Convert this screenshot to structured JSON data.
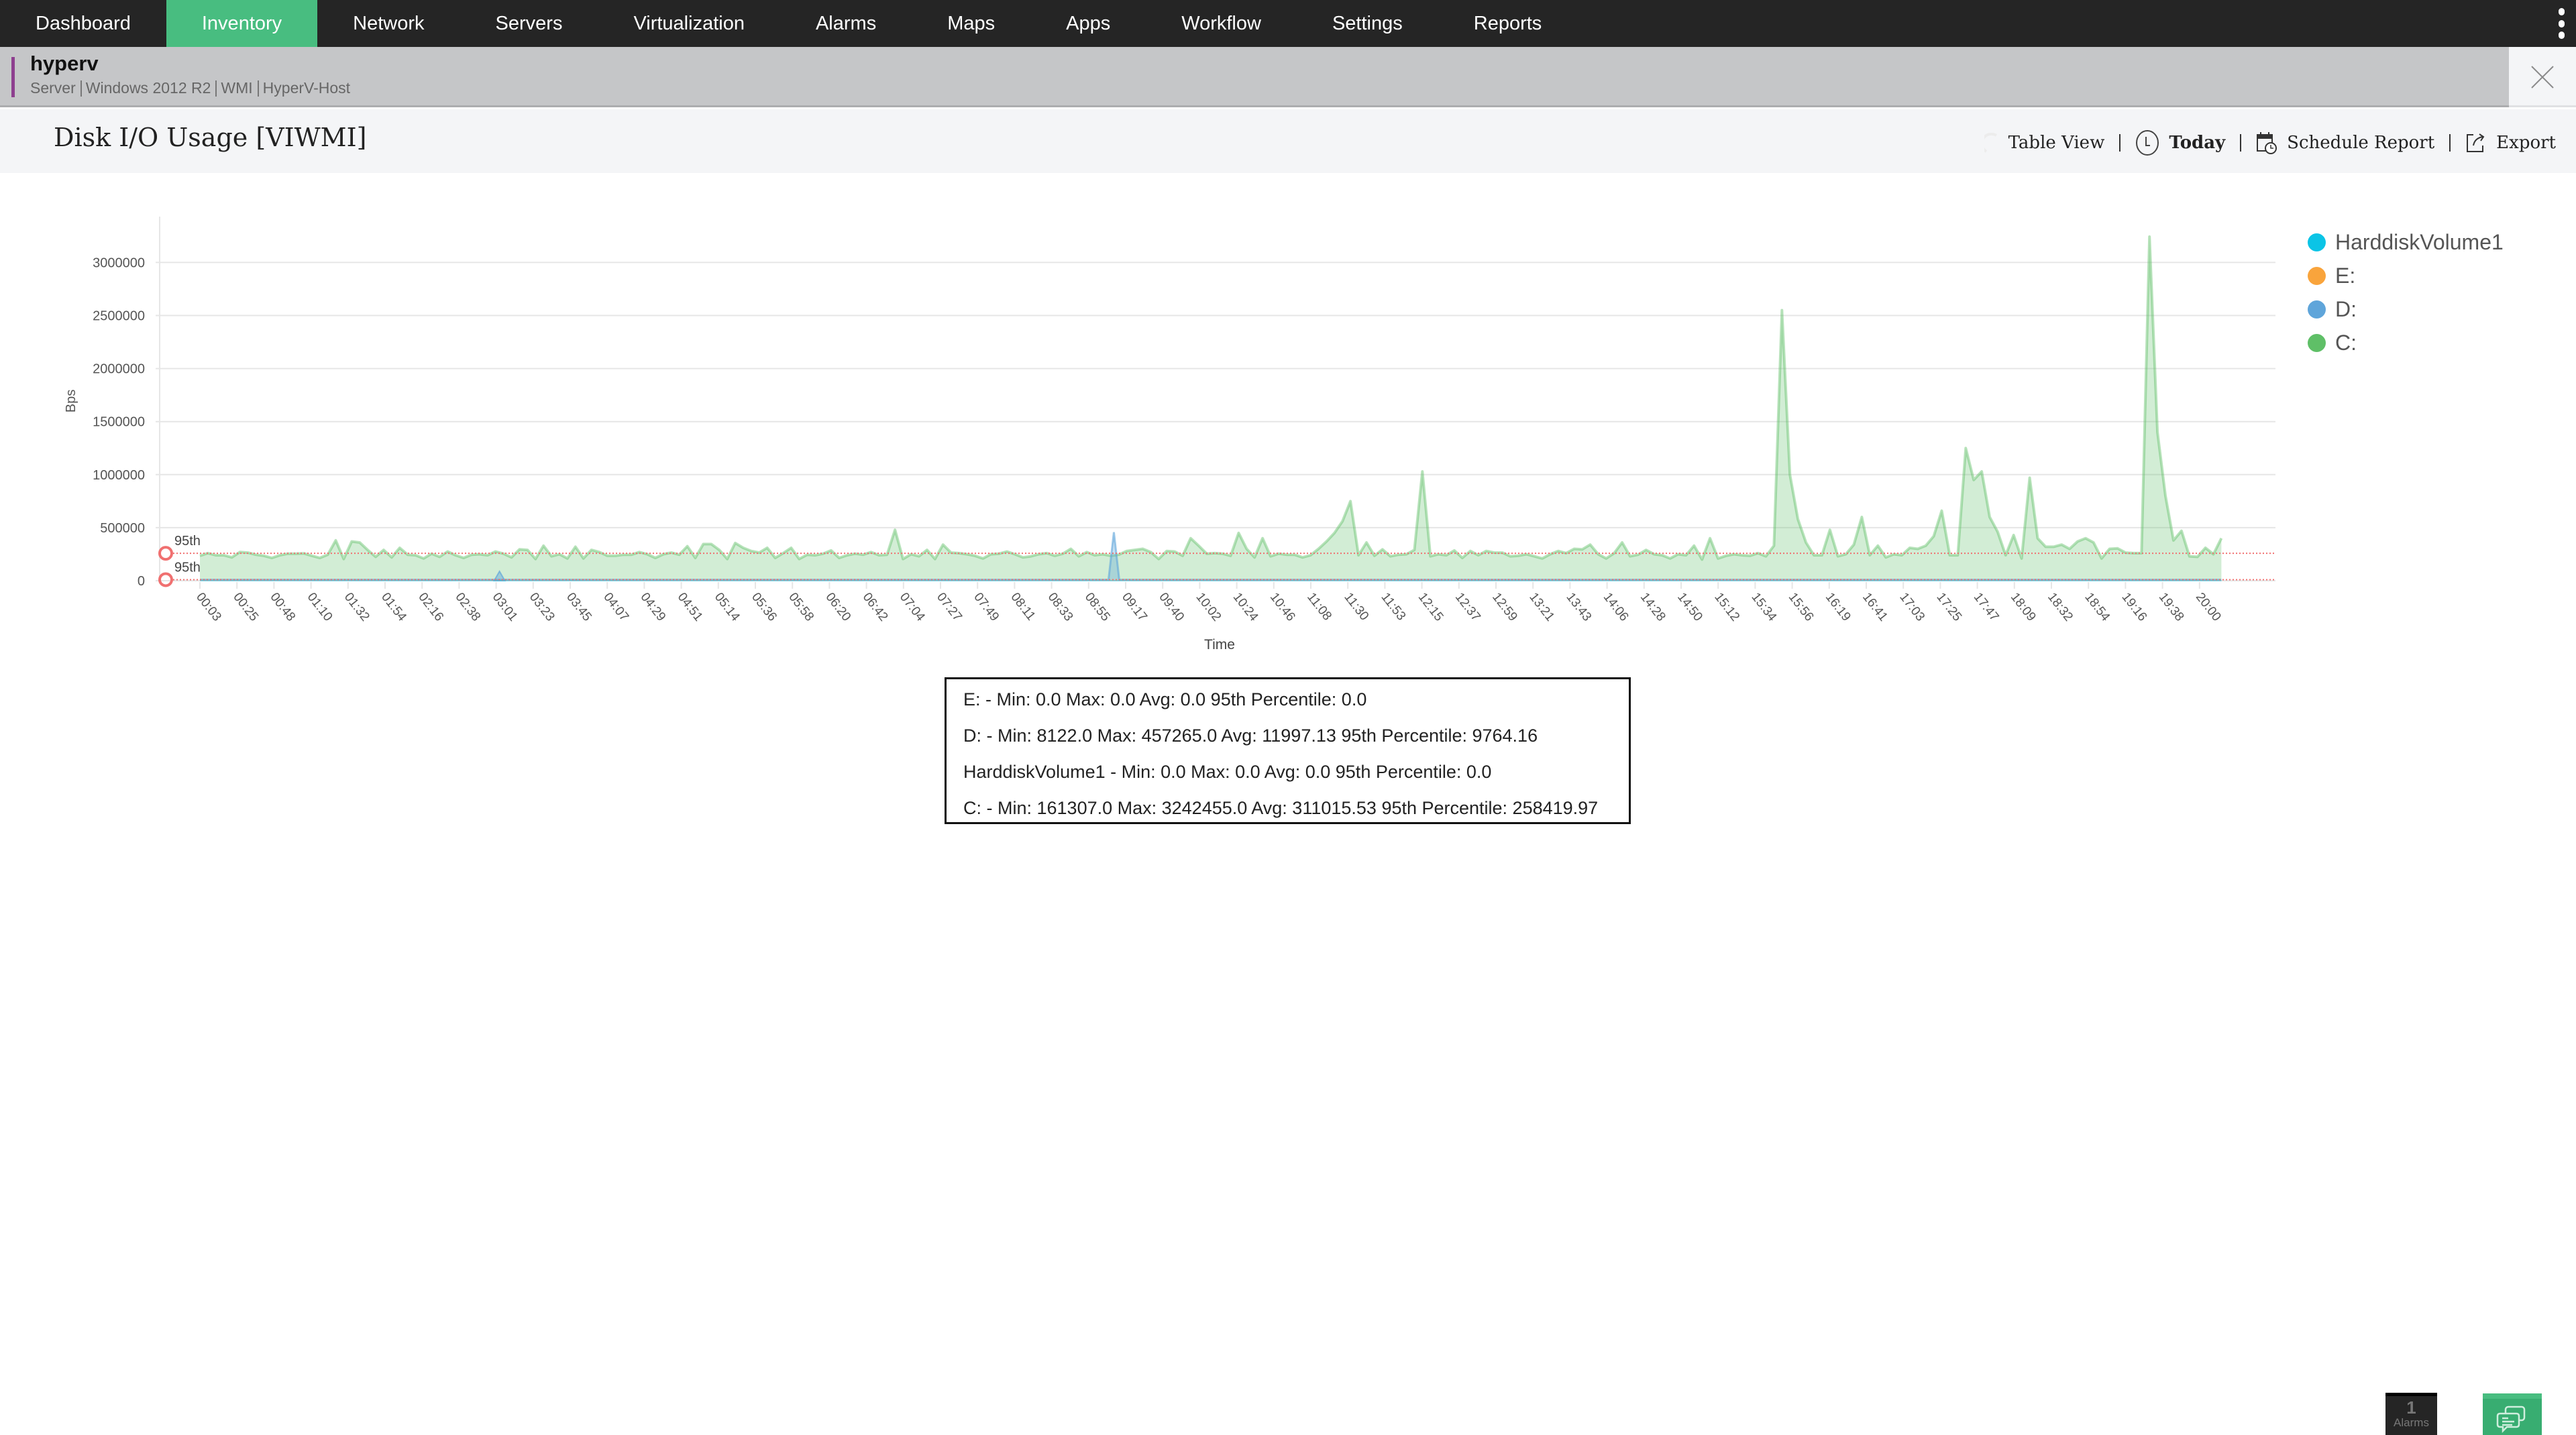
{
  "nav": {
    "items": [
      {
        "label": "Dashboard",
        "active": false
      },
      {
        "label": "Inventory",
        "active": true
      },
      {
        "label": "Network",
        "active": false
      },
      {
        "label": "Servers",
        "active": false
      },
      {
        "label": "Virtualization",
        "active": false
      },
      {
        "label": "Alarms",
        "active": false
      },
      {
        "label": "Maps",
        "active": false
      },
      {
        "label": "Apps",
        "active": false
      },
      {
        "label": "Workflow",
        "active": false
      },
      {
        "label": "Settings",
        "active": false
      },
      {
        "label": "Reports",
        "active": false
      }
    ],
    "more_icon": "vertical-ellipsis-icon"
  },
  "device": {
    "name": "hyperv",
    "meta": [
      "Server",
      "Windows 2012 R2",
      "WMI",
      "HyperV-Host"
    ],
    "close_icon": "close-icon"
  },
  "page": {
    "title": "Disk I/O Usage [VIWMI]",
    "actions": [
      {
        "label": "Table View",
        "icon": "gauge-icon"
      },
      {
        "label": "Today",
        "icon": "clock-icon"
      },
      {
        "label": "Schedule Report",
        "icon": "calendar-clock-icon"
      },
      {
        "label": "Export",
        "icon": "export-icon"
      }
    ]
  },
  "colors": {
    "nav_bg": "#252525",
    "nav_active": "#48bd80",
    "device_accent": "#8e3f8f",
    "percentile_line": "#f07070"
  },
  "chart_data": {
    "type": "area",
    "title": "Disk I/O Usage [VIWMI]",
    "xlabel": "Time",
    "ylabel": "Bps",
    "ylim": [
      0,
      3300000
    ],
    "yticks": [
      0,
      500000,
      1000000,
      1500000,
      2000000,
      2500000,
      3000000
    ],
    "ytick_labels": [
      "0",
      "500000",
      "1000000",
      "1500000",
      "2000000",
      "2500000",
      "3000000"
    ],
    "xtick_labels": [
      "00:03",
      "00:25",
      "00:48",
      "01:10",
      "01:32",
      "01:54",
      "02:16",
      "02:38",
      "03:01",
      "03:23",
      "03:45",
      "04:07",
      "04:29",
      "04:51",
      "05:14",
      "05:36",
      "05:58",
      "06:20",
      "06:42",
      "07:04",
      "07:27",
      "07:49",
      "08:11",
      "08:33",
      "08:55",
      "09:17",
      "09:40",
      "10:02",
      "10:24",
      "10:46",
      "11:08",
      "11:30",
      "11:53",
      "12:15",
      "12:37",
      "12:59",
      "13:21",
      "13:43",
      "14:06",
      "14:28",
      "14:50",
      "15:12",
      "15:34",
      "15:56",
      "16:19",
      "16:41",
      "17:03",
      "17:25",
      "17:47",
      "18:09",
      "18:32",
      "18:54",
      "19:16",
      "19:38",
      "20:00"
    ],
    "grid": true,
    "legend_position": "right",
    "percentile_markers": [
      {
        "label": "95th",
        "value": 258419.97
      },
      {
        "label": "95th",
        "value": 9764.16
      }
    ],
    "series": [
      {
        "name": "HarddiskVolume1",
        "color": "#0bc4e6",
        "values": "all 0"
      },
      {
        "name": "E:",
        "color": "#f9a43c",
        "values": "all 0"
      },
      {
        "name": "D:",
        "color": "#5fa5da",
        "baseline": 9764,
        "spike": {
          "time": "09:06",
          "value": 457265
        }
      },
      {
        "name": "C:",
        "color": "#5fbf67",
        "values": [
          235000,
          260000,
          240000,
          240000,
          220000,
          270000,
          265000,
          245000,
          235000,
          215000,
          240000,
          255000,
          255000,
          258000,
          235000,
          215000,
          245000,
          380000,
          205000,
          370000,
          360000,
          290000,
          225000,
          290000,
          220000,
          310000,
          245000,
          240000,
          210000,
          255000,
          225000,
          275000,
          240000,
          215000,
          245000,
          250000,
          240000,
          275000,
          255000,
          220000,
          295000,
          290000,
          205000,
          330000,
          230000,
          250000,
          210000,
          320000,
          210000,
          290000,
          270000,
          235000,
          235000,
          245000,
          245000,
          270000,
          250000,
          215000,
          250000,
          265000,
          245000,
          325000,
          215000,
          345000,
          345000,
          290000,
          205000,
          355000,
          310000,
          280000,
          265000,
          310000,
          215000,
          260000,
          310000,
          205000,
          245000,
          240000,
          255000,
          285000,
          215000,
          240000,
          255000,
          245000,
          270000,
          240000,
          245000,
          480000,
          205000,
          250000,
          230000,
          290000,
          205000,
          340000,
          265000,
          260000,
          250000,
          235000,
          210000,
          250000,
          255000,
          275000,
          250000,
          220000,
          230000,
          250000,
          260000,
          235000,
          255000,
          300000,
          230000,
          270000,
          240000,
          250000,
          235000,
          245000,
          280000,
          290000,
          300000,
          270000,
          205000,
          280000,
          275000,
          235000,
          400000,
          330000,
          255000,
          260000,
          255000,
          235000,
          450000,
          300000,
          220000,
          400000,
          230000,
          255000,
          245000,
          245000,
          220000,
          240000,
          300000,
          370000,
          450000,
          560000,
          750000,
          240000,
          360000,
          235000,
          295000,
          230000,
          245000,
          250000,
          290000,
          1030000,
          230000,
          250000,
          240000,
          285000,
          215000,
          280000,
          240000,
          280000,
          265000,
          265000,
          230000,
          235000,
          250000,
          230000,
          210000,
          250000,
          280000,
          260000,
          300000,
          295000,
          340000,
          250000,
          210000,
          260000,
          360000,
          230000,
          245000,
          290000,
          250000,
          240000,
          210000,
          250000,
          240000,
          330000,
          200000,
          400000,
          210000,
          235000,
          250000,
          240000,
          235000,
          260000,
          230000,
          330000,
          2550000,
          1000000,
          580000,
          360000,
          240000,
          240000,
          480000,
          230000,
          250000,
          340000,
          600000,
          240000,
          330000,
          220000,
          250000,
          240000,
          310000,
          300000,
          330000,
          420000,
          660000,
          240000,
          240000,
          1250000,
          950000,
          1030000,
          600000,
          460000,
          240000,
          430000,
          210000,
          970000,
          400000,
          320000,
          320000,
          340000,
          300000,
          370000,
          400000,
          360000,
          210000,
          300000,
          305000,
          265000,
          260000,
          260000,
          3242455,
          1400000,
          800000,
          380000,
          470000,
          230000,
          225000,
          310000,
          250000,
          400000
        ]
      }
    ],
    "summary": [
      "E: - Min: 0.0 Max: 0.0 Avg: 0.0 95th Percentile: 0.0",
      "D: - Min: 8122.0 Max: 457265.0 Avg: 11997.13 95th Percentile: 9764.16",
      "HarddiskVolume1 - Min: 0.0 Max: 0.0 Avg: 0.0 95th Percentile: 0.0",
      "C: - Min: 161307.0 Max: 3242455.0 Avg: 311015.53 95th Percentile: 258419.97"
    ]
  },
  "footer": {
    "alarms_count": "1",
    "alarms_label": "Alarms",
    "chat_icon": "chat-icon"
  }
}
